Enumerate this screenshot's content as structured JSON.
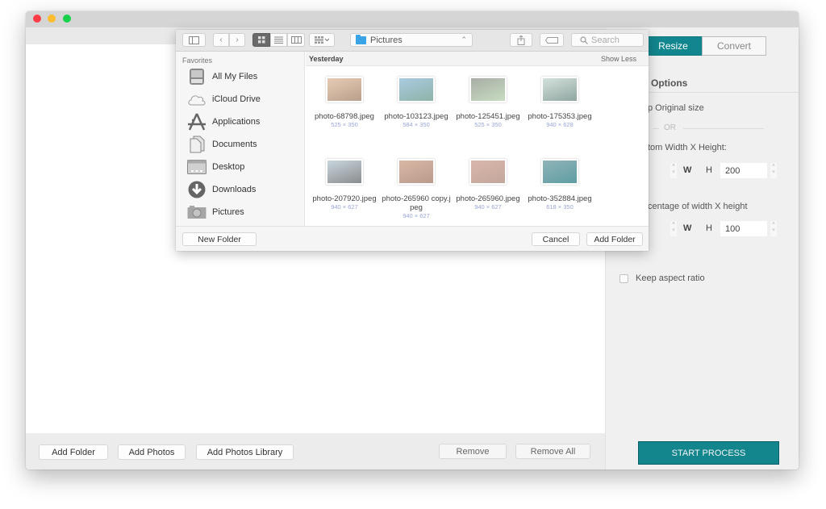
{
  "window": {
    "traffic_lights": [
      "close",
      "minimize",
      "zoom"
    ]
  },
  "bottom_bar": {
    "add_folder": "Add Folder",
    "add_photos": "Add Photos",
    "add_photos_library": "Add Photos Library",
    "remove": "Remove",
    "remove_all": "Remove All"
  },
  "right_panel": {
    "tabs": [
      {
        "label": "Resize",
        "active": true
      },
      {
        "label": "Convert",
        "active": false
      }
    ],
    "options_title": "Options",
    "keep_original": "p Original size",
    "or_label": "OR",
    "custom_label": "tom Width X Height:",
    "custom_w_label": "W",
    "custom_h_label": "H",
    "custom_width_value": "",
    "custom_height_value": "200",
    "percentage_label": "centage of width X height",
    "percent_w_label": "W",
    "percent_h_label": "H",
    "percent_width_value": "",
    "percent_height_value": "100",
    "keep_aspect_label": "Keep aspect ratio",
    "keep_aspect_checked": false,
    "start_button": "START PROCESS",
    "accent_color": "#13868d"
  },
  "dialog": {
    "toolbar": {
      "sidebar_toggle_icon": "sidebar-icon",
      "back_icon": "chevron-left-icon",
      "forward_icon": "chevron-right-icon",
      "view_modes": [
        "icon-view",
        "list-view",
        "column-view"
      ],
      "active_view": "icon-view",
      "arrange_icon": "arrange-icon",
      "location": "Pictures",
      "share_icon": "share-icon",
      "tag_icon": "tag-icon",
      "search_placeholder": "Search"
    },
    "sidebar": {
      "section": "Favorites",
      "items": [
        {
          "label": "All My Files",
          "icon": "all-files-icon"
        },
        {
          "label": "iCloud Drive",
          "icon": "cloud-icon"
        },
        {
          "label": "Applications",
          "icon": "applications-icon"
        },
        {
          "label": "Documents",
          "icon": "documents-icon"
        },
        {
          "label": "Desktop",
          "icon": "desktop-icon"
        },
        {
          "label": "Downloads",
          "icon": "downloads-icon"
        },
        {
          "label": "Pictures",
          "icon": "camera-icon"
        }
      ]
    },
    "content": {
      "section_title": "Yesterday",
      "show_less": "Show Less",
      "files": [
        {
          "name": "photo-68798.jpeg",
          "display": "photo-68798.jpe g",
          "dims": "525 × 350",
          "tint": [
            "#e7cbb4",
            "#b9a08c"
          ]
        },
        {
          "name": "photo-103123.jpeg",
          "display": "photo-103123.jpe g",
          "dims": "584 × 350",
          "tint": [
            "#a9cbe0",
            "#8db3a8"
          ]
        },
        {
          "name": "photo-125451.jpeg",
          "display": "photo-125451.jpe g",
          "dims": "525 × 350",
          "tint": [
            "#a8ada6",
            "#c7dcc0"
          ]
        },
        {
          "name": "photo-175353.jpeg",
          "display": "photo-175353.jpe g",
          "dims": "940 × 628",
          "tint": [
            "#d4e2dc",
            "#8fa5a0"
          ]
        },
        {
          "name": "photo-207920.jpeg",
          "display": "photo-207920.jpe g",
          "dims": "940 × 627",
          "tint": [
            "#c9d6de",
            "#8a8c8e"
          ]
        },
        {
          "name": "photo-265960 copy.jpeg",
          "display": "photo-265960 copy.jpeg",
          "dims": "940 × 627",
          "tint": [
            "#d9b7a5",
            "#b99b8c"
          ]
        },
        {
          "name": "photo-265960.jpeg",
          "display": "photo-265960.jp eg",
          "dims": "940 × 627",
          "tint": [
            "#dab6ab",
            "#c2a79c"
          ]
        },
        {
          "name": "photo-352884.jpeg",
          "display": "photo-352884.jp eg",
          "dims": "618 × 350",
          "tint": [
            "#8fb3b8",
            "#5f9ea4"
          ]
        }
      ]
    },
    "footer": {
      "new_folder": "New Folder",
      "cancel": "Cancel",
      "add_folder": "Add Folder"
    }
  }
}
